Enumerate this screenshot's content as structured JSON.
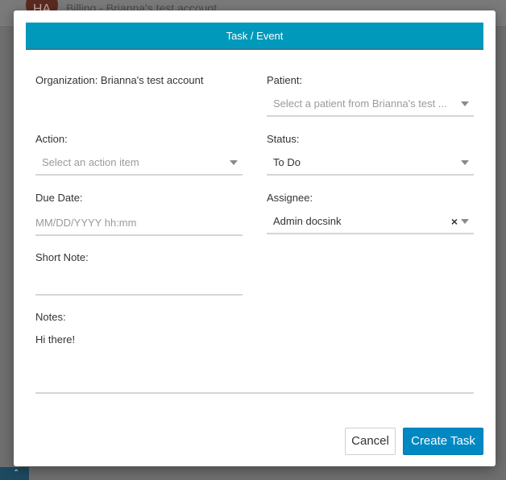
{
  "background": {
    "avatar_initials": "HA",
    "title": "Billing - Brianna's test account"
  },
  "modal": {
    "title": "Task / Event",
    "organization_text": "Organization: Brianna's test account",
    "patient": {
      "label": "Patient:",
      "placeholder": "Select a patient from Brianna's test ..."
    },
    "action": {
      "label": "Action:",
      "placeholder": "Select an action item"
    },
    "status": {
      "label": "Status:",
      "value": "To Do"
    },
    "due_date": {
      "label": "Due Date:",
      "placeholder": "MM/DD/YYYY hh:mm"
    },
    "assignee": {
      "label": "Assignee:",
      "value": "Admin docsink",
      "clear_glyph": "×"
    },
    "short_note": {
      "label": "Short Note:",
      "value": ""
    },
    "notes": {
      "label": "Notes:",
      "value": "Hi there!"
    },
    "buttons": {
      "cancel": "Cancel",
      "create": "Create Task"
    }
  },
  "colors": {
    "header": "#0099bb",
    "primary_button": "#0088c2"
  }
}
